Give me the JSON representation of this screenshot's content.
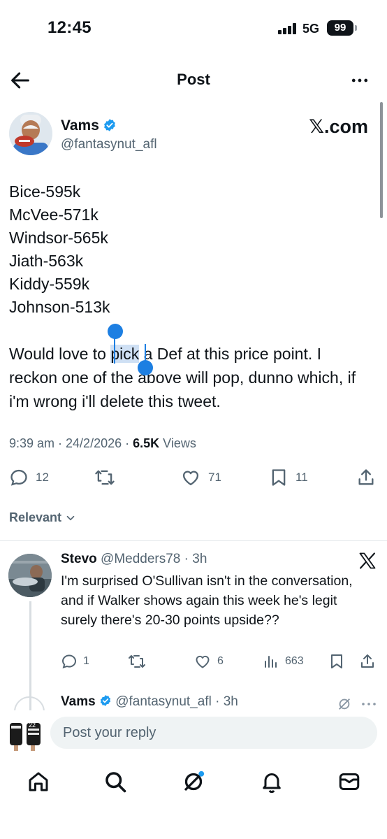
{
  "status_bar": {
    "time": "12:45",
    "network": "5G",
    "battery": "99"
  },
  "header": {
    "title": "Post"
  },
  "post": {
    "author_name": "Vams",
    "author_handle": "@fantasynut_afl",
    "source_badge": "𝕏.com",
    "list_lines": [
      "Bice-595k",
      "McVee-571k",
      "Windsor-565k",
      "Jiath-563k",
      "Kiddy-559k",
      "Johnson-513k"
    ],
    "para_line1_before": "Would love to ",
    "para_line1_selected": "pick",
    "para_line1_after": " a Def at this price point. I",
    "para_line2": "reckon one of the above will pop, dunno which, if",
    "para_line3": "i'm wrong i'll delete this tweet.",
    "meta_time": "9:39 am · 24/2/2026 · ",
    "meta_views_count": "6.5K",
    "meta_views_label": " Views",
    "replies": "12",
    "likes": "71",
    "bookmarks": "11"
  },
  "sort": {
    "label": "Relevant"
  },
  "reply": {
    "name": "Stevo",
    "handle_time": " @Medders78 · 3h",
    "text": "I'm surprised O'Sullivan isn't in the conversation, and if Walker shows again this week he's legit surely there's 20-30 points upside??",
    "replies": "1",
    "likes": "6",
    "views": "663"
  },
  "next_reply": {
    "name": "Vams",
    "handle_time": " @fantasynut_afl · 3h"
  },
  "compose": {
    "placeholder": "Post your reply"
  },
  "colors": {
    "accent": "#1d9bf0",
    "selection_handle": "#1d7fe2",
    "secondary_text": "#536471"
  }
}
